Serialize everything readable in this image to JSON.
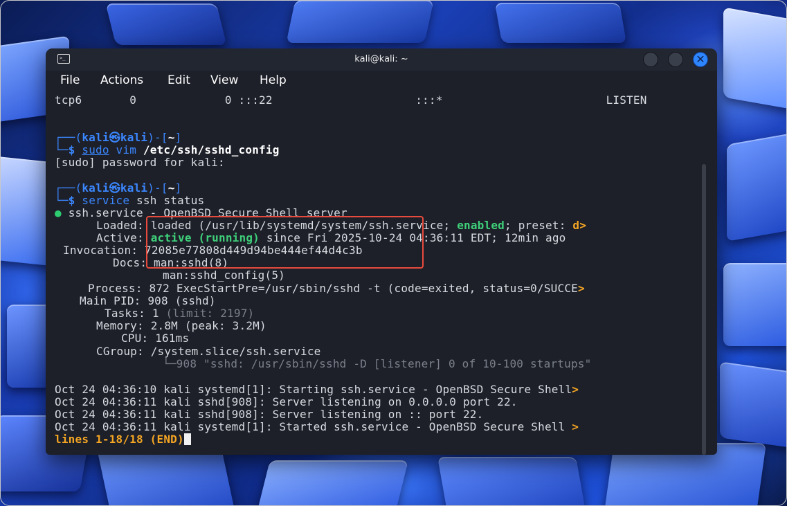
{
  "window": {
    "title": "kali@kali: ~"
  },
  "menu": {
    "items": [
      "File",
      "Actions",
      "Edit",
      "View",
      "Help"
    ]
  },
  "terminal": {
    "netstat": {
      "proto": "tcp6",
      "recv": "0",
      "send": "0",
      "local": ":::22",
      "foreign": ":::*",
      "state": "LISTEN"
    },
    "prompt1": {
      "user": "kali",
      "at_glyph": "㉿",
      "host": "kali",
      "dir": "~",
      "cmd_sudo": "sudo",
      "cmd_vim": "vim",
      "cmd_path": "/etc/ssh/sshd_config"
    },
    "sudo_prompt": "[sudo] password for kali:",
    "prompt2": {
      "user": "kali",
      "at_glyph": "㉿",
      "host": "kali",
      "dir": "~",
      "cmd": "service",
      "args": "ssh status"
    },
    "status": {
      "dot": "●",
      "unit_line": "ssh.service - OpenBSD Secure Shell server",
      "loaded_label": "Loaded:",
      "loaded_pre": "loaded (/usr/lib/systemd/system/ssh.service;",
      "loaded_enabled": "enabled",
      "loaded_post": "; preset: ",
      "loaded_trunc": "d>",
      "active_label": "Active:",
      "active_state": "active (running)",
      "active_since": "since Fri 2025-10-24 04:36:11 EDT; 12min ago",
      "invocation_label": "Invocation:",
      "invocation_id": "72085e77808d449d94be444ef44d4c3b",
      "docs_label": "Docs:",
      "docs_1": "man:sshd(8)",
      "docs_2": "man:sshd_config(5)",
      "process_label": "Process:",
      "process_value": "872 ExecStartPre=/usr/sbin/sshd -t (code=exited, status=0/SUCCE",
      "process_trunc": ">",
      "mainpid_label": "Main PID:",
      "mainpid_value": "908 (sshd)",
      "tasks_label": "Tasks:",
      "tasks_value": "1",
      "tasks_limit": "(limit: 2197)",
      "memory_label": "Memory:",
      "memory_value": "2.8M (peak: 3.2M)",
      "cpu_label": "CPU:",
      "cpu_value": "161ms",
      "cgroup_label": "CGroup:",
      "cgroup_value": "/system.slice/ssh.service",
      "cgroup_child": "└─908 \"sshd: /usr/sbin/sshd -D [listener] 0 of 10-100 startups\""
    },
    "log": [
      {
        "text": "Oct 24 04:36:10 kali systemd[1]: Starting ssh.service - OpenBSD Secure Shell",
        "trunc": ">"
      },
      {
        "text": "Oct 24 04:36:11 kali sshd[908]: Server listening on 0.0.0.0 port 22.",
        "trunc": ""
      },
      {
        "text": "Oct 24 04:36:11 kali sshd[908]: Server listening on :: port 22.",
        "trunc": ""
      },
      {
        "text": "Oct 24 04:36:11 kali systemd[1]: Started ssh.service - OpenBSD Secure Shell ",
        "trunc": ">"
      }
    ],
    "pager_status": "lines 1-18/18 (END)"
  },
  "colors": {
    "prompt_blue": "#3b87ff",
    "running_green": "#3fd07a",
    "truncate_orange": "#f5a623",
    "highlight_red": "#e84a3c",
    "terminal_bg": "#1d2029"
  }
}
